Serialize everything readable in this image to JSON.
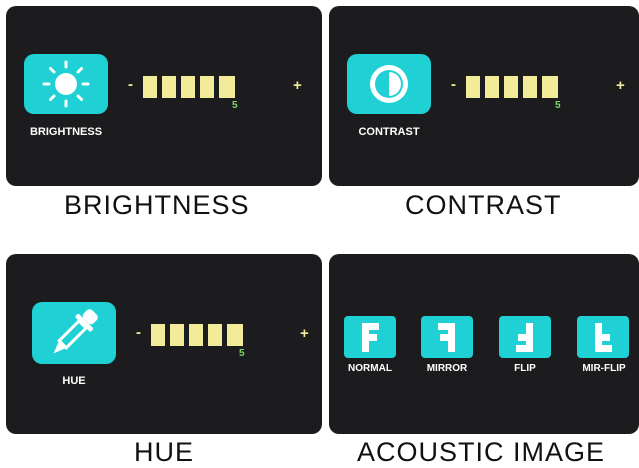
{
  "brightness": {
    "tile_label": "BRIGHTNESS",
    "caption": "BRIGHTNESS",
    "minus": "-",
    "plus": "+",
    "level": "5",
    "bars": 5,
    "icon": "sun-icon"
  },
  "contrast": {
    "tile_label": "CONTRAST",
    "caption": "CONTRAST",
    "minus": "-",
    "plus": "+",
    "level": "5",
    "bars": 5,
    "icon": "contrast-icon"
  },
  "hue": {
    "tile_label": "HUE",
    "caption": "HUE",
    "minus": "-",
    "plus": "+",
    "level": "5",
    "bars": 5,
    "icon": "dropper-icon"
  },
  "acoustic_image": {
    "caption": "ACOUSTIC IMAGE",
    "modes": [
      {
        "label": "NORMAL",
        "icon": "f-normal-icon"
      },
      {
        "label": "MIRROR",
        "icon": "f-mirror-icon"
      },
      {
        "label": "FLIP",
        "icon": "f-flip-icon"
      },
      {
        "label": "MIR-FLIP",
        "icon": "f-mirflip-icon"
      }
    ]
  },
  "colors": {
    "panel": "#1c1c1e",
    "tile": "#1fd0d4",
    "bar": "#f2ec9a",
    "level": "#7bd86a"
  }
}
